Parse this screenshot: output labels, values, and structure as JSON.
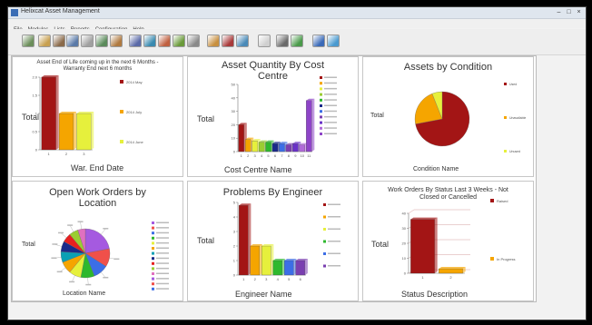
{
  "window": {
    "title": "Helixcat Asset Management"
  },
  "menu": [
    "File",
    "Modules",
    "Lists",
    "Reports",
    "Configuration",
    "Help"
  ],
  "toolbar": {
    "buttons": [
      "assets-icon",
      "asset-register-icon",
      "locations-icon",
      "cost-centres-icon",
      "suppliers-icon",
      "tools-icon",
      "users-icon",
      "work-orders-icon",
      "problems-icon",
      "schedule-icon",
      "reports-icon",
      "calendar-icon",
      "documents-icon",
      "stock-icon",
      "purchase-icon",
      "notes-icon",
      "import-icon",
      "export-icon",
      "settings-icon",
      "help-icon"
    ]
  },
  "chart_data": [
    {
      "type": "bar",
      "title": "Asset End of Life coming up in the next 6 Months - Warranty End next 6 months",
      "xlabel": "War. End Date",
      "ylabel": "Total",
      "categories": [
        "1",
        "2",
        "3"
      ],
      "series": [
        {
          "name": "2014 May",
          "color": "#a31515",
          "values": [
            2
          ]
        },
        {
          "name": "2014 July",
          "color": "#f5a500",
          "values": [
            1
          ]
        },
        {
          "name": "2014 June",
          "color": "#e6f03c",
          "values": [
            1
          ]
        }
      ],
      "ylim": [
        0,
        2
      ],
      "yticks": [
        "0",
        "0.5",
        "1",
        "1.5",
        "2.0"
      ],
      "legend": "right"
    },
    {
      "type": "bar",
      "title": "Asset Quantity By Cost Centre",
      "xlabel": "Cost Centre Name",
      "ylabel": "Total",
      "categories": [
        "1",
        "2",
        "3",
        "4",
        "5",
        "6",
        "7",
        "8",
        "9",
        "10",
        "11"
      ],
      "values": [
        20,
        9,
        8,
        7,
        7,
        6,
        6,
        5,
        6,
        5,
        38
      ],
      "colors": [
        "#a31515",
        "#f5a500",
        "#e6f03c",
        "#9acd32",
        "#2eb82e",
        "#1a2a8a",
        "#3c6ee6",
        "#7a3fb0",
        "#6a32c8",
        "#b06ad8",
        "#8e44c8"
      ],
      "ylim": [
        0,
        50
      ],
      "yticks": [
        "0",
        "10",
        "20",
        "30",
        "40",
        "50"
      ],
      "legend": "right",
      "legend_count": 11
    },
    {
      "type": "pie",
      "title": "Assets by Condition",
      "xlabel": "Condition Name",
      "ylabel": "Total",
      "slices": [
        {
          "name": "Used",
          "value": 72,
          "color": "#a31515"
        },
        {
          "name": "Unavailable",
          "value": 22,
          "color": "#f5a500"
        },
        {
          "name": "Unused",
          "value": 6,
          "color": "#e6f03c"
        }
      ],
      "legend": "right"
    },
    {
      "type": "pie",
      "title": "Open Work Orders by Location",
      "xlabel": "Location Name",
      "ylabel": "Total",
      "slices": [
        {
          "value": 22,
          "color": "#a55ae0"
        },
        {
          "value": 12,
          "color": "#f0504a"
        },
        {
          "value": 10,
          "color": "#3c6ee6"
        },
        {
          "value": 9,
          "color": "#2eb82e"
        },
        {
          "value": 8,
          "color": "#e6f03c"
        },
        {
          "value": 8,
          "color": "#f5a500"
        },
        {
          "value": 7,
          "color": "#0aa0b4"
        },
        {
          "value": 7,
          "color": "#1a2a8a"
        },
        {
          "value": 6,
          "color": "#e62020"
        },
        {
          "value": 6,
          "color": "#9acd32"
        },
        {
          "value": 5,
          "color": "#e070c0"
        }
      ],
      "legend": "right",
      "legend_count": 14
    },
    {
      "type": "bar",
      "title": "Problems By Engineer",
      "xlabel": "Engineer Name",
      "ylabel": "Total",
      "categories": [
        "1",
        "2",
        "3",
        "4",
        "5",
        "6"
      ],
      "values": [
        4.8,
        2,
        2,
        1,
        1,
        1
      ],
      "colors": [
        "#a31515",
        "#f5a500",
        "#e6f03c",
        "#2eb82e",
        "#3c6ee6",
        "#7a3fb0"
      ],
      "ylim": [
        0,
        5
      ],
      "yticks": [
        "0",
        "1",
        "2",
        "3",
        "4",
        "5"
      ],
      "legend": "right",
      "legend_count": 6
    },
    {
      "type": "bar",
      "title": "Work Orders By Status Last 3 Weeks - Not Closed or Cancelled",
      "xlabel": "Status Description",
      "ylabel": "Total",
      "categories": [
        "1",
        "2"
      ],
      "series": [
        {
          "name": "Raised",
          "color": "#a31515",
          "values": [
            36
          ]
        },
        {
          "name": "In Progress",
          "color": "#f5a500",
          "values": [
            3
          ]
        }
      ],
      "ylim": [
        0,
        40
      ],
      "yticks": [
        "0",
        "10",
        "20",
        "30",
        "40"
      ],
      "legend": "right"
    }
  ]
}
